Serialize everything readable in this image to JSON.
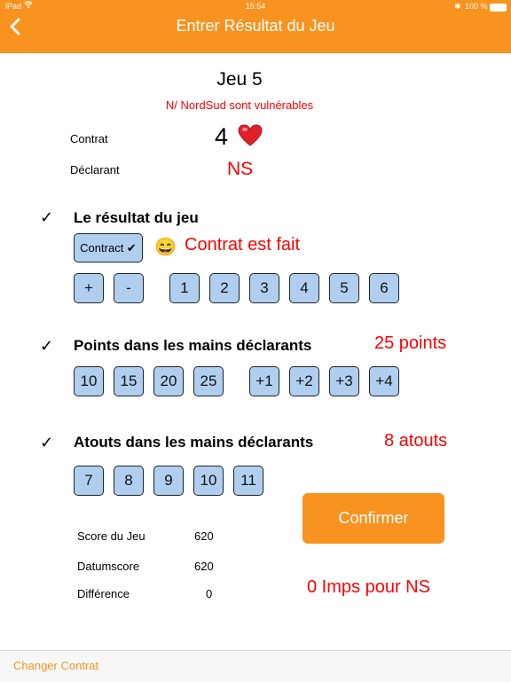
{
  "status_bar": {
    "device": "iPad",
    "time": "15:54",
    "battery": "100 %"
  },
  "nav": {
    "title": "Entrer Résultat du Jeu"
  },
  "game": {
    "title": "Jeu 5",
    "vulnerability": "N/ NordSud sont vulnérables",
    "contract_label": "Contrat",
    "contract_level": "4",
    "declarer_label": "Déclarant",
    "declarer_value": "NS"
  },
  "result": {
    "title": "Le résultat du jeu",
    "contract_button": "Contract ✔",
    "emoji": "😄",
    "status": "Contrat est fait",
    "keys": [
      "+",
      "-",
      "1",
      "2",
      "3",
      "4",
      "5",
      "6"
    ]
  },
  "points": {
    "title": "Points dans les mains déclarants",
    "value": "25 points",
    "keys": [
      "10",
      "15",
      "20",
      "25",
      "+1",
      "+2",
      "+3",
      "+4"
    ]
  },
  "trumps": {
    "title": "Atouts dans les mains déclarants",
    "value": "8 atouts",
    "keys": [
      "7",
      "8",
      "9",
      "10",
      "11"
    ]
  },
  "confirm_button": "Confirmer",
  "scores": {
    "game_score_label": "Score du Jeu",
    "game_score": "620",
    "datum_label": "Datumscore",
    "datum": "620",
    "diff_label": "Différence",
    "diff": "0"
  },
  "imps": "0 Imps pour NS",
  "bottom": {
    "change_contract": "Changer Contrat"
  },
  "colors": {
    "accent": "#f7931e",
    "key_bg": "#b0cff0",
    "result_red": "#ff0000"
  }
}
